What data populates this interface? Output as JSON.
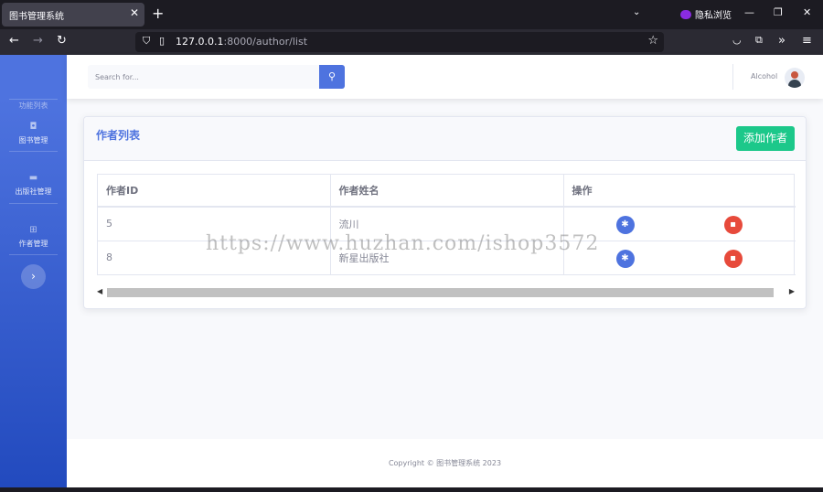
{
  "browser": {
    "tab_title": "图书管理系统",
    "tab_close": "✕",
    "new_tab": "+",
    "tab_list": "⌄",
    "private_label": "隐私浏览",
    "minimize": "—",
    "restore": "❐",
    "close": "✕",
    "url_host": "127.0.0.1",
    "url_rest": ":8000/author/list"
  },
  "sidebar": {
    "heading": "功能列表",
    "items": [
      {
        "label": "图书管理",
        "icon": "camera-icon"
      },
      {
        "label": "出版社管理",
        "icon": "folder-icon"
      },
      {
        "label": "作者管理",
        "icon": "table-icon"
      }
    ],
    "toggle": "›"
  },
  "topbar": {
    "search_placeholder": "Search for...",
    "user_name": "Alcohol"
  },
  "card": {
    "title": "作者列表",
    "add_button": "添加作者"
  },
  "table": {
    "headers": [
      "作者ID",
      "作者姓名",
      "操作"
    ],
    "rows": [
      {
        "id": "5",
        "name": "流川"
      },
      {
        "id": "8",
        "name": "新星出版社"
      }
    ]
  },
  "footer": {
    "copyright": "Copyright © 图书管理系统 2023"
  },
  "watermark": "https://www.huzhan.com/ishop3572",
  "colors": {
    "primary": "#4e73df",
    "success": "#1cc88a",
    "danger": "#e74a3b"
  }
}
